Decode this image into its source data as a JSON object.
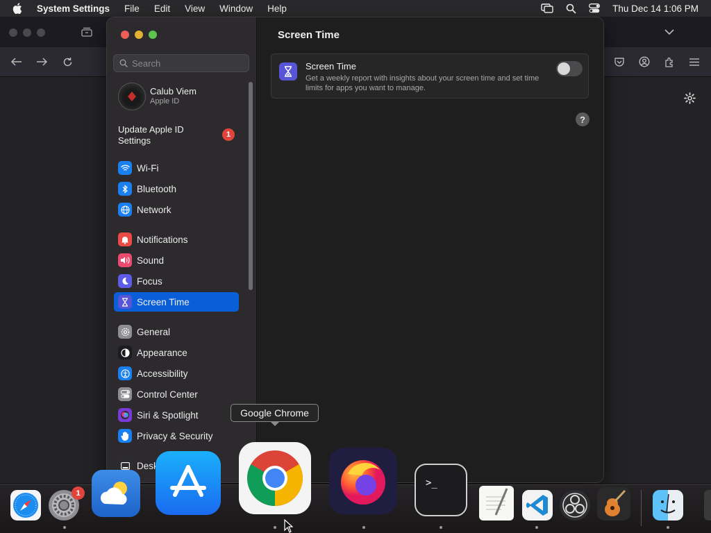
{
  "menubar": {
    "app_name": "System Settings",
    "menus": [
      "File",
      "Edit",
      "View",
      "Window",
      "Help"
    ],
    "clock": "Thu Dec 14  1:06 PM"
  },
  "sidebar": {
    "search_placeholder": "Search",
    "account": {
      "name": "Calub Viem",
      "subtitle": "Apple ID"
    },
    "update": {
      "label": "Update Apple ID Settings",
      "badge": "1"
    },
    "groups": [
      [
        {
          "label": "Wi-Fi",
          "icon": "wifi-icon",
          "color": "#1a7ff0"
        },
        {
          "label": "Bluetooth",
          "icon": "bluetooth-icon",
          "color": "#1a7ff0"
        },
        {
          "label": "Network",
          "icon": "globe-icon",
          "color": "#1a7ff0"
        }
      ],
      [
        {
          "label": "Notifications",
          "icon": "bell-icon",
          "color": "#eb4b45"
        },
        {
          "label": "Sound",
          "icon": "speaker-icon",
          "color": "#eb4b6e"
        },
        {
          "label": "Focus",
          "icon": "moon-icon",
          "color": "#5e5ce6"
        },
        {
          "label": "Screen Time",
          "icon": "hourglass-icon",
          "color": "#5856d6",
          "selected": true
        }
      ],
      [
        {
          "label": "General",
          "icon": "gear-icon",
          "color": "#8e8e93"
        },
        {
          "label": "Appearance",
          "icon": "appearance-icon",
          "color": "#1c1c1e"
        },
        {
          "label": "Accessibility",
          "icon": "accessibility-icon",
          "color": "#1a7ff0"
        },
        {
          "label": "Control Center",
          "icon": "control-center-icon",
          "color": "#8e8e93"
        },
        {
          "label": "Siri & Spotlight",
          "icon": "siri-icon",
          "color": "#7a3ad6"
        },
        {
          "label": "Privacy & Security",
          "icon": "hand-icon",
          "color": "#1a7ff0"
        },
        {
          "label": "Desktop & Dock",
          "icon": "desktop-icon",
          "color": "#2c2c2e"
        }
      ]
    ]
  },
  "content": {
    "title": "Screen Time",
    "card": {
      "title": "Screen Time",
      "description": "Get a weekly report with insights about your screen time and set time limits for apps you want to manage.",
      "toggle_on": false
    },
    "help_label": "?"
  },
  "tooltip": {
    "text": "Google Chrome"
  },
  "dock": {
    "settings_badge": "1",
    "apps": [
      "Safari",
      "System Settings",
      "Weather",
      "App Store",
      "Google Chrome",
      "Firefox",
      "Terminal",
      "TextEdit",
      "Visual Studio Code",
      "OBS",
      "GarageBand",
      "Finder"
    ]
  }
}
